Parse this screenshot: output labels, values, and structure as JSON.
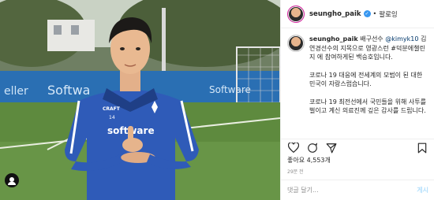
{
  "header": {
    "username": "seungho_paik",
    "verified_icon": "verified-badge-icon",
    "separator": "•",
    "follow_label": "팔로잉"
  },
  "caption": {
    "username": "seungho_paik",
    "line1_prefix": " 배구선수 ",
    "mention": "@kimyk10",
    "line1_rest": " 김연경선수의 지목으로 영광스런 #덕분에챌린지 에 참여하게된 백승호입니다.",
    "para2": "코로나 19 대응에 전세계의 모범이 된 대한민국이 자랑스럽습니다.",
    "para3": "코로나 19 최전선에서 국민들을 위해 사투를 벌이고 계신 의료진께 깊은 감사를 드립니다."
  },
  "actions": {
    "like_icon": "heart-icon",
    "comment_icon": "comment-icon",
    "share_icon": "share-icon",
    "save_icon": "bookmark-icon"
  },
  "stats": {
    "likes": "좋아요 4,553개",
    "time": "29분 전"
  },
  "comment": {
    "placeholder": "댓글 달기...",
    "post_label": "게시"
  },
  "photo": {
    "jersey_text": "software",
    "sponsor_craft": "CRAFT",
    "jersey_number": "14",
    "banner_text": "Softwa",
    "banner_text2": "Software",
    "banner_left": "eller"
  },
  "colors": {
    "jersey": "#2f5bb8",
    "link": "#00376b",
    "verified": "#3897f0"
  }
}
